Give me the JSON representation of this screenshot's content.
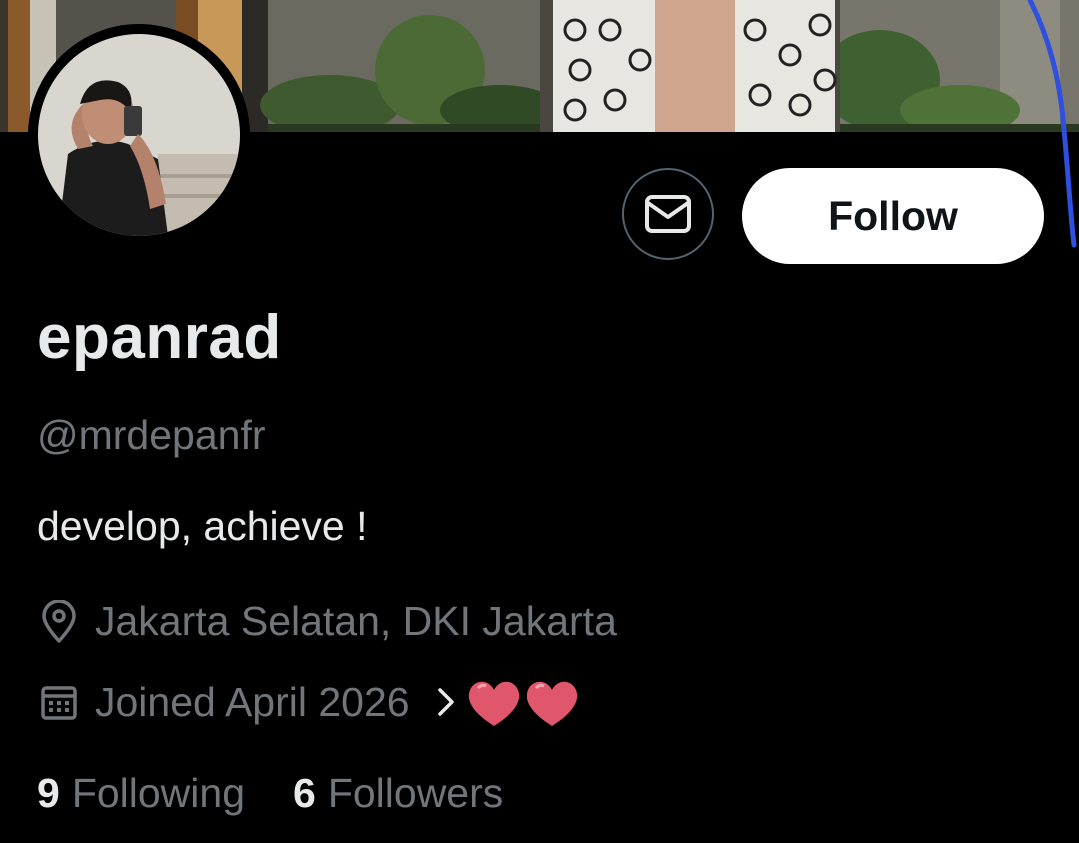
{
  "profile": {
    "display_name": "epanrad",
    "handle": "@mrdepanfr",
    "bio": "develop, achieve !",
    "location": "Jakarta Selatan, DKI Jakarta",
    "joined": "Joined April 2026"
  },
  "actions": {
    "follow_label": "Follow"
  },
  "stats": {
    "following_count": "9",
    "following_label": "Following",
    "followers_count": "6",
    "followers_label": "Followers"
  },
  "icons": {
    "message": "mail-icon",
    "location": "location-pin-icon",
    "calendar": "calendar-icon",
    "chevron": "chevron-right-icon",
    "hearts": "heart-emoji-icon"
  },
  "colors": {
    "background": "#000000",
    "primary_text": "#e7e9ea",
    "secondary_text": "#71767b",
    "follow_button_bg": "#ffffff",
    "follow_button_text": "#0f1419",
    "heart": "#e0566b",
    "annotation_pen": "#2f4fe0"
  }
}
